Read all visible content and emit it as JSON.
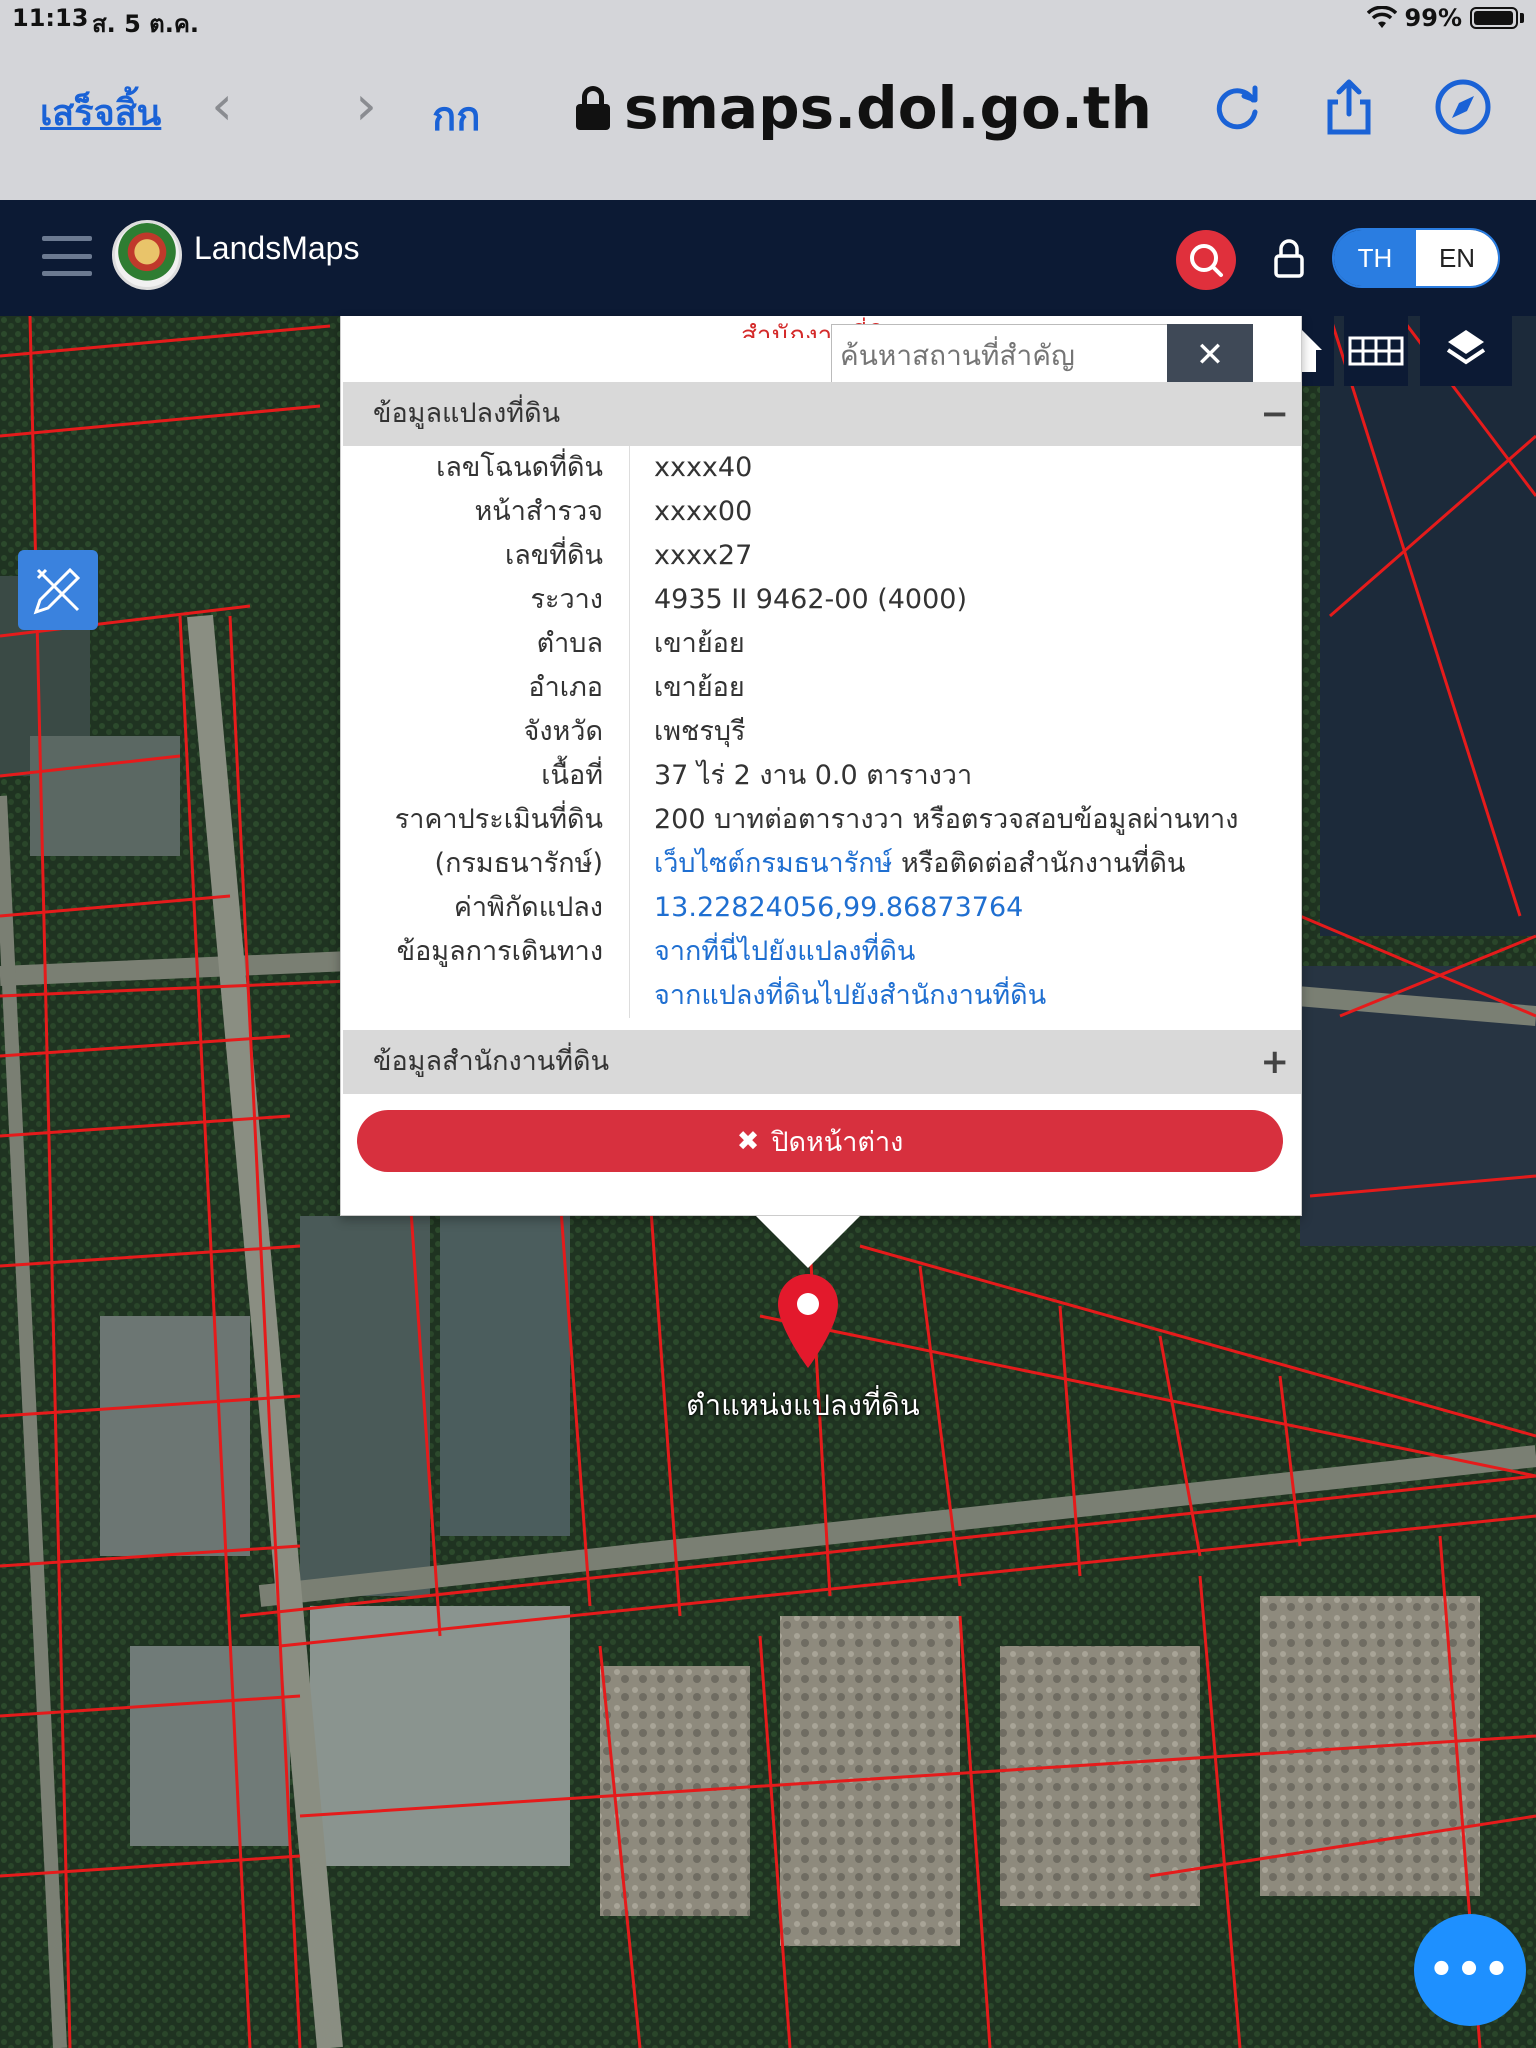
{
  "status_bar": {
    "time": "11:13",
    "date": "ส. 5 ต.ค.",
    "battery": "99%"
  },
  "browser": {
    "done_label": "เสร็จสิ้น",
    "aa_label": "กก",
    "address": "smaps.dol.go.th"
  },
  "header": {
    "brand": "LandsMaps",
    "lang_th": "TH",
    "lang_en": "EN"
  },
  "popup": {
    "office_peek": "สำนักงานที่ดิน",
    "search_placeholder": "ค้นหาสถานที่สำคัญ",
    "search_close": "✕",
    "section_parcel": "ข้อมูลแปลงที่ดิน",
    "section_parcel_toggle": "−",
    "rows": [
      {
        "label": "เลขโฉนดที่ดิน",
        "value": "xxxx40"
      },
      {
        "label": "หน้าสำรวจ",
        "value": "xxxx00"
      },
      {
        "label": "เลขที่ดิน",
        "value": "xxxx27"
      },
      {
        "label": "ระวาง",
        "value": "4935 II 9462-00 (4000)"
      },
      {
        "label": "ตำบล",
        "value": "เขาย้อย"
      },
      {
        "label": "อำเภอ",
        "value": "เขาย้อย"
      },
      {
        "label": "จังหวัด",
        "value": "เพชรบุรี"
      },
      {
        "label": "เนื้อที่",
        "value": "37 ไร่ 2 งาน 0.0 ตารางวา"
      },
      {
        "label": "ราคาประเมินที่ดิน",
        "value": "200 บาทต่อตารางวา หรือตรวจสอบข้อมูลผ่านทาง"
      },
      {
        "label": "(กรมธนารักษ์)",
        "link": "เว็บไซต์กรมธนารักษ์",
        "value": " หรือติดต่อสำนักงานที่ดิน"
      },
      {
        "label": "ค่าพิกัดแปลง",
        "link": "13.22824056,99.86873764"
      },
      {
        "label": "ข้อมูลการเดินทาง",
        "link": "จากที่นี่ไปยังแปลงที่ดิน"
      },
      {
        "label": "",
        "link": "จากแปลงที่ดินไปยังสำนักงานที่ดิน"
      }
    ],
    "section_office": "ข้อมูลสำนักงานที่ดิน",
    "section_office_toggle": "+",
    "close_label": "ปิดหน้าต่าง"
  },
  "map": {
    "pin_label": "ตำแหน่งแปลงที่ดิน",
    "fab_label": "•••",
    "pin_color": "#e3192c",
    "boundary_color": "#e51b1b"
  }
}
